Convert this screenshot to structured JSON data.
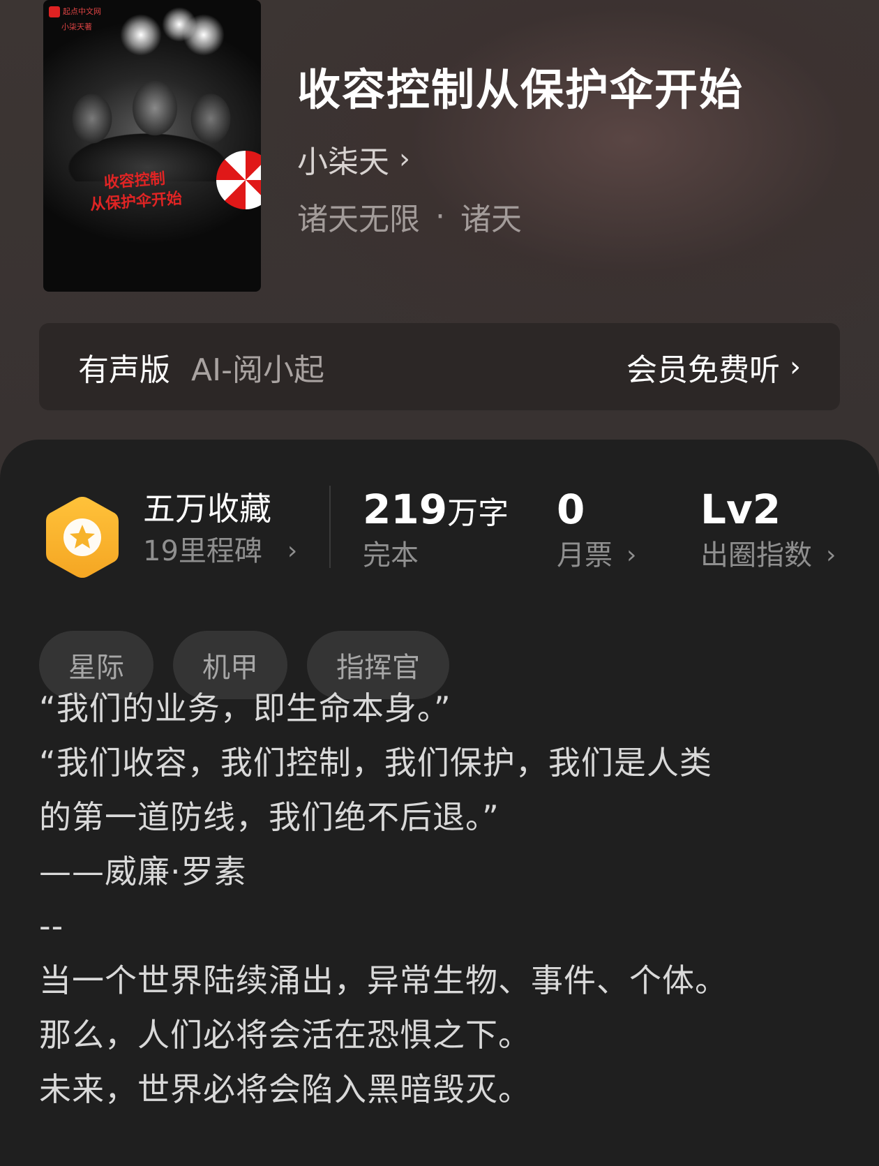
{
  "header": {
    "cover": {
      "publisher": "起点中文网",
      "cover_author": "小柒天著",
      "cover_title_line1": "收容控制",
      "cover_title_line2": "从保护伞开始"
    },
    "title": "收容控制从保护伞开始",
    "author": "小柒天",
    "genre": "诸天无限",
    "subgenre": "诸天",
    "genre_separator": "·"
  },
  "audio": {
    "label": "有声版",
    "narrator": "AI-阅小起",
    "cta": "会员免费听"
  },
  "stats": {
    "favorites": {
      "main": "五万收藏",
      "sub": "19里程碑"
    },
    "words": {
      "num": "219",
      "unit": "万字",
      "sub": "完本"
    },
    "monthly_votes": {
      "num": "0",
      "sub": "月票"
    },
    "circle_index": {
      "num": "Lv2",
      "sub": "出圈指数"
    }
  },
  "tags": [
    "星际",
    "机甲",
    "指挥官"
  ],
  "synopsis": [
    "“我们的业务，即生命本身。”",
    "“我们收容，我们控制，我们保护，我们是人类",
    "的第一道防线，我们绝不后退。”",
    "——威廉·罗素",
    "--",
    "当一个世界陆续涌出，异常生物、事件、个体。",
    "那么，人们必将会活在恐惧之下。",
    "未来，世界必将会陷入黑暗毁灭。"
  ],
  "colors": {
    "badge_gradient_top": "#ffc23a",
    "badge_gradient_bottom": "#f5a623",
    "umbrella_red": "#e01818"
  }
}
